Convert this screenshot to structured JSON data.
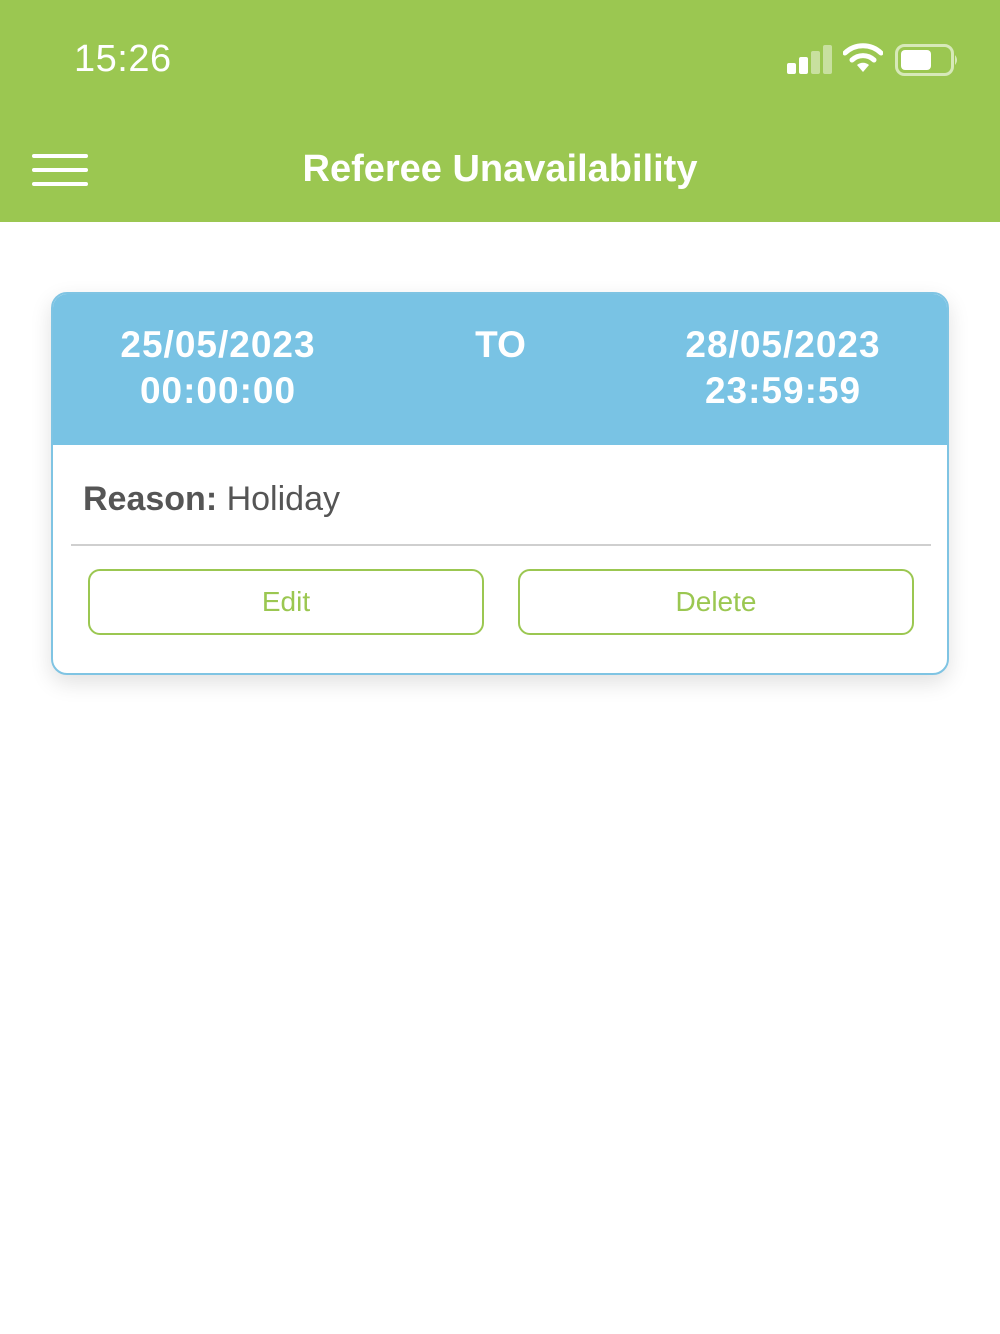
{
  "status_bar": {
    "time": "15:26"
  },
  "header": {
    "title": "Referee Unavailability",
    "menu_icon": "hamburger-menu-icon",
    "color": "#9bc751"
  },
  "card": {
    "header_color": "#79c3e4",
    "from_date": "25/05/2023",
    "from_time": "00:00:00",
    "to_label": "TO",
    "to_date": "28/05/2023",
    "to_time": "23:59:59",
    "reason_label": "Reason:",
    "reason_value": "Holiday",
    "edit_label": "Edit",
    "delete_label": "Delete"
  }
}
